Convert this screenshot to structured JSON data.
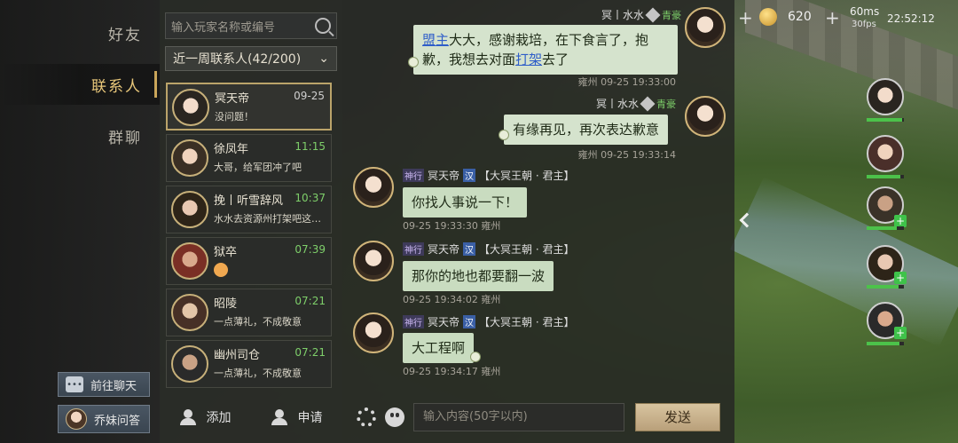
{
  "tabs": [
    {
      "label": "好友",
      "active": false
    },
    {
      "label": "联系人",
      "active": true
    },
    {
      "label": "群聊",
      "active": false
    }
  ],
  "side_buttons": {
    "goto_chat": "前往聊天",
    "qiaomei": "乔妹问答"
  },
  "search": {
    "placeholder": "输入玩家名称或编号"
  },
  "filter": {
    "label": "近一周联系人(42/200)"
  },
  "contacts": [
    {
      "name": "冥天帝",
      "time": "09-25",
      "msg": "没问题！",
      "selected": true
    },
    {
      "name": "徐凤年",
      "time": "11:15",
      "msg": "大哥，给军团冲了吧"
    },
    {
      "name": "挽丨听雪辞风",
      "time": "10:37",
      "msg": "水水去资源州打架吧这…"
    },
    {
      "name": "狱卒",
      "time": "07:39",
      "msg": ""
    },
    {
      "name": "昭陵",
      "time": "07:21",
      "msg": "一点薄礼，不成敬意"
    },
    {
      "name": "幽州司仓",
      "time": "07:21",
      "msg": "一点薄礼，不成敬意"
    }
  ],
  "bottom_left": {
    "add": "添加",
    "apply": "申请"
  },
  "messages": [
    {
      "sender": "冥丨水水",
      "rank": "青豪",
      "mine": true,
      "text_parts": [
        "盟主",
        "大大，感谢栽培，在下食言了，抱歉，",
        "我想去对面",
        "打架",
        "去了"
      ],
      "timestamp": "雍州 09-25 19:33:00"
    },
    {
      "sender": "冥丨水水",
      "rank": "青豪",
      "mine": true,
      "text": "有缘再见，再次表达歉意",
      "timestamp": "雍州 09-25 19:33:14"
    },
    {
      "tag": "神行",
      "sender": "冥天帝",
      "han": "汉",
      "faction": "【大冥王朝 · 君主】",
      "mine": false,
      "text": "你找人事说一下！",
      "timestamp": "09-25 19:33:30 雍州"
    },
    {
      "tag": "神行",
      "sender": "冥天帝",
      "han": "汉",
      "faction": "【大冥王朝 · 君主】",
      "mine": false,
      "text": "那你的地也都要翻一波",
      "timestamp": "09-25 19:34:02 雍州"
    },
    {
      "tag": "神行",
      "sender": "冥天帝",
      "han": "汉",
      "faction": "【大冥王朝 · 君主】",
      "mine": false,
      "text": "大工程啊",
      "timestamp": "09-25 19:34:17 雍州"
    }
  ],
  "input": {
    "placeholder": "输入内容(50字以内)",
    "send": "发送"
  },
  "hud": {
    "gold": "620",
    "ping": "60ms",
    "fps": "30fps",
    "clock": "22:52:12"
  },
  "colors": {
    "accent_gold": "#c9a55a",
    "bubble_bg": "#c9dcc0",
    "online_green": "#7ecf6a",
    "link_blue": "#2f5ec9"
  }
}
